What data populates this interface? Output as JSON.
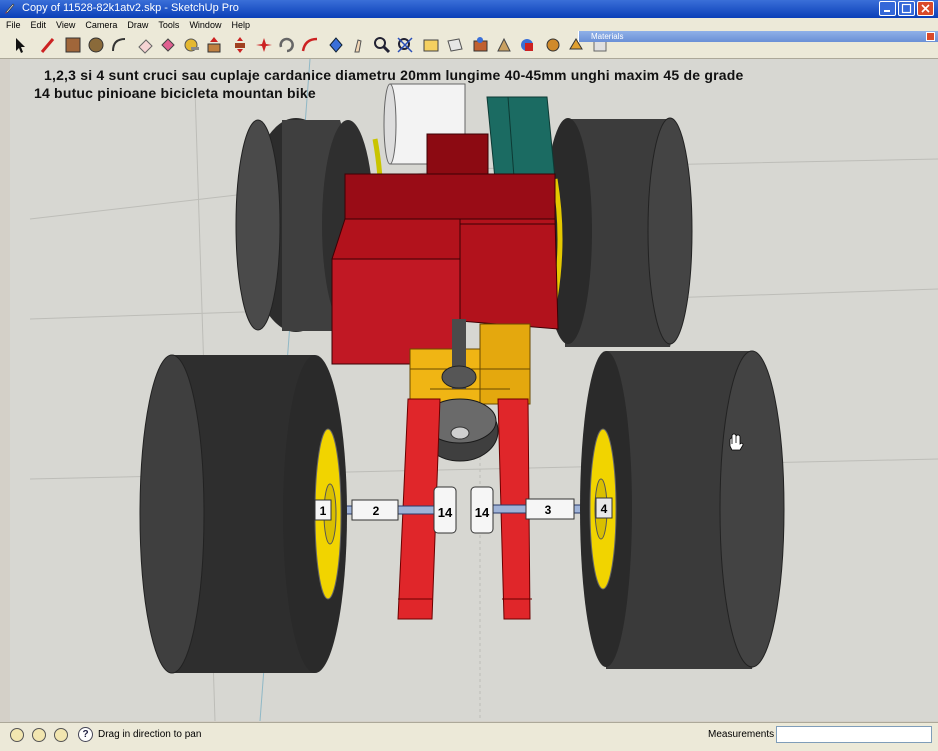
{
  "window": {
    "title": "Copy of 11528-82k1atv2.skp - SketchUp Pro"
  },
  "menu": [
    "File",
    "Edit",
    "View",
    "Camera",
    "Draw",
    "Tools",
    "Window",
    "Help"
  ],
  "toolbar": {
    "tools": [
      "select-icon",
      "line-icon",
      "rectangle-icon",
      "circle-icon",
      "arc-icon",
      "eraser-icon",
      "paint-bucket-icon",
      "tape-measure-icon",
      "push-pull-icon",
      "move-icon",
      "rotate-icon",
      "follow-me-icon",
      "scale-icon",
      "offset-icon",
      "orbit-icon",
      "pan-icon",
      "zoom-icon",
      "zoom-extents-icon",
      "previous-view-icon",
      "next-view-icon",
      "get-models-icon",
      "share-model-icon",
      "components-icon",
      "materials-icon",
      "styles-icon",
      "layers-icon"
    ]
  },
  "materials_panel": {
    "title": "Materials"
  },
  "annotation": {
    "line1": "1,2,3 si 4 sunt cruci sau cuplaje cardanice diametru 20mm lungime 40-45mm unghi maxim 45 de grade",
    "line2": "14 butuc pinioane bicicleta mountan bike"
  },
  "model": {
    "labels": {
      "joint1": "1",
      "joint2": "2",
      "joint3": "3",
      "joint4": "4",
      "hub_left": "14",
      "hub_right": "14"
    },
    "colors": {
      "tire": "#3b3b3b",
      "rim": "#f1d400",
      "body_red": "#a8101a",
      "frame_red": "#e0262a",
      "frame_yellow": "#f0b514",
      "teal": "#1b6b62",
      "white_part": "#f2f2f2",
      "ground": "#d7d7d2"
    }
  },
  "status": {
    "hint": "Drag in direction to pan",
    "measurements_label": "Measurements",
    "measurements_value": ""
  }
}
